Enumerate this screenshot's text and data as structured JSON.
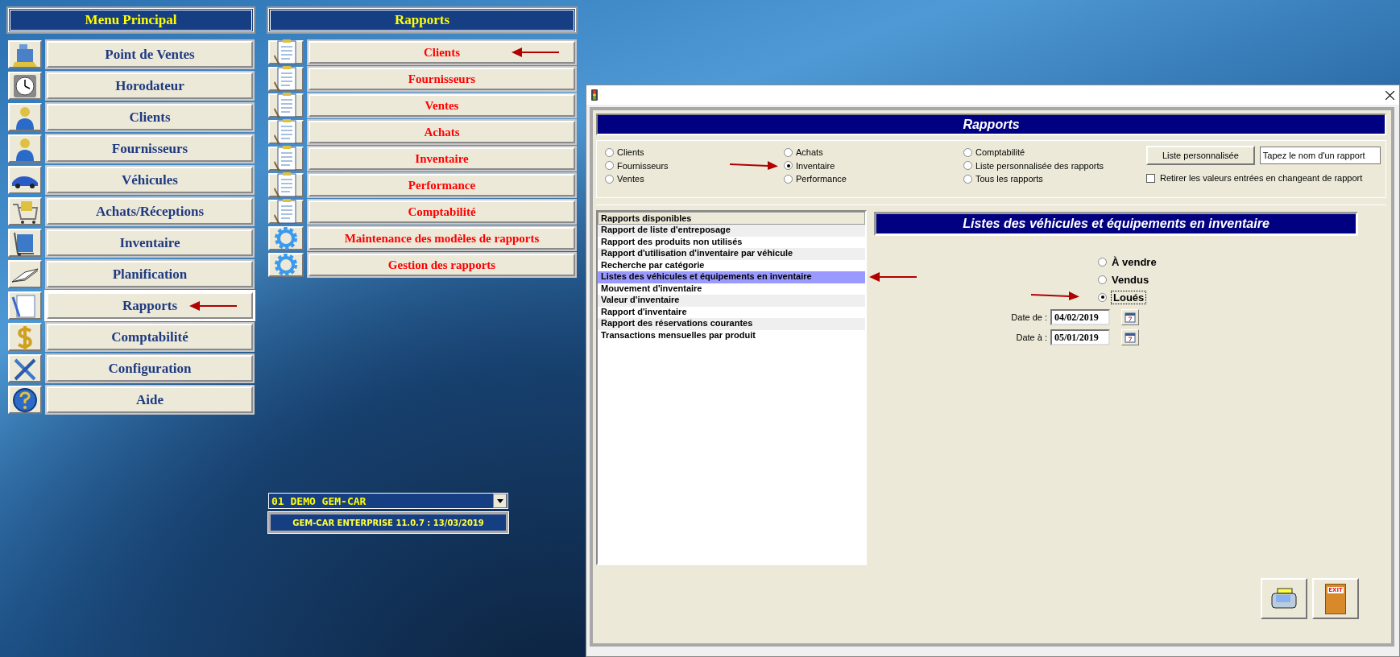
{
  "main_menu": {
    "title": "Menu Principal",
    "items": [
      {
        "label": "Point de Ventes",
        "selected": false,
        "arrow": false
      },
      {
        "label": "Horodateur",
        "selected": false,
        "arrow": false
      },
      {
        "label": "Clients",
        "selected": false,
        "arrow": false
      },
      {
        "label": "Fournisseurs",
        "selected": false,
        "arrow": false
      },
      {
        "label": "Véhicules",
        "selected": false,
        "arrow": false
      },
      {
        "label": "Achats/Réceptions",
        "selected": false,
        "arrow": false
      },
      {
        "label": "Inventaire",
        "selected": false,
        "arrow": false
      },
      {
        "label": "Planification",
        "selected": false,
        "arrow": false
      },
      {
        "label": "Rapports",
        "selected": true,
        "arrow": true
      },
      {
        "label": "Comptabilité",
        "selected": false,
        "arrow": false
      },
      {
        "label": "Configuration",
        "selected": false,
        "arrow": false
      },
      {
        "label": "Aide",
        "selected": false,
        "arrow": false
      }
    ]
  },
  "reports_menu": {
    "title": "Rapports",
    "items": [
      {
        "label": "Clients",
        "arrow": true
      },
      {
        "label": "Fournisseurs",
        "arrow": false
      },
      {
        "label": "Ventes",
        "arrow": false
      },
      {
        "label": "Achats",
        "arrow": false
      },
      {
        "label": "Inventaire",
        "arrow": false
      },
      {
        "label": "Performance",
        "arrow": false
      },
      {
        "label": "Comptabilité",
        "arrow": false
      },
      {
        "label": "Maintenance des modèles de rapports",
        "arrow": false
      },
      {
        "label": "Gestion des rapports",
        "arrow": false
      }
    ]
  },
  "company_select": {
    "value": "01 DEMO GEM-CAR"
  },
  "version": "GEM-CAR ENTERPRISE 11.0.7 : 13/03/2019",
  "dialog": {
    "header": "Rapports",
    "report_types": [
      {
        "label": "Clients",
        "selected": false,
        "arrow": false
      },
      {
        "label": "Fournisseurs",
        "selected": false,
        "arrow": false
      },
      {
        "label": "Ventes",
        "selected": false,
        "arrow": false
      },
      {
        "label": "Achats",
        "selected": false,
        "arrow": false
      },
      {
        "label": "Inventaire",
        "selected": true,
        "arrow": true
      },
      {
        "label": "Performance",
        "selected": false,
        "arrow": false
      },
      {
        "label": "Comptabilité",
        "selected": false,
        "arrow": false
      },
      {
        "label": "Liste personnalisée des rapports",
        "selected": false,
        "arrow": false
      },
      {
        "label": "Tous les rapports",
        "selected": false,
        "arrow": false
      }
    ],
    "custom_list_button": "Liste personnalisée",
    "search": {
      "placeholder": "Tapez le nom d'un rapport"
    },
    "clear_values": {
      "label": "Retirer les valeurs entrées en changeant de rapport",
      "checked": false
    },
    "report_list": {
      "header": "Rapports disponibles",
      "items": [
        {
          "label": "Rapport de liste d'entreposage",
          "selected": false,
          "arrow": false
        },
        {
          "label": "Rapport des produits non utilisés",
          "selected": false,
          "arrow": false
        },
        {
          "label": "Rapport d'utilisation d'inventaire par véhicule",
          "selected": false,
          "arrow": false
        },
        {
          "label": "Recherche par catégorie",
          "selected": false,
          "arrow": false
        },
        {
          "label": "Listes des véhicules et équipements en inventaire",
          "selected": true,
          "arrow": true
        },
        {
          "label": "Mouvement d'inventaire",
          "selected": false,
          "arrow": false
        },
        {
          "label": "Valeur d'inventaire",
          "selected": false,
          "arrow": false
        },
        {
          "label": "Rapport d'inventaire",
          "selected": false,
          "arrow": false
        },
        {
          "label": "Rapport des réservations courantes",
          "selected": false,
          "arrow": false
        },
        {
          "label": "Transactions mensuelles par produit",
          "selected": false,
          "arrow": false
        }
      ]
    },
    "detail": {
      "title": "Listes des véhicules et équipements en inventaire",
      "options": [
        {
          "label": "À vendre",
          "selected": false,
          "arrow": false
        },
        {
          "label": "Vendus",
          "selected": false,
          "arrow": false
        },
        {
          "label": "Loués",
          "selected": true,
          "arrow": true
        }
      ],
      "date_from": {
        "label": "Date de :",
        "value": "04/02/2019"
      },
      "date_to": {
        "label": "Date à :",
        "value": "05/01/2019"
      }
    },
    "exit_button": {
      "label": "EXIT"
    }
  }
}
